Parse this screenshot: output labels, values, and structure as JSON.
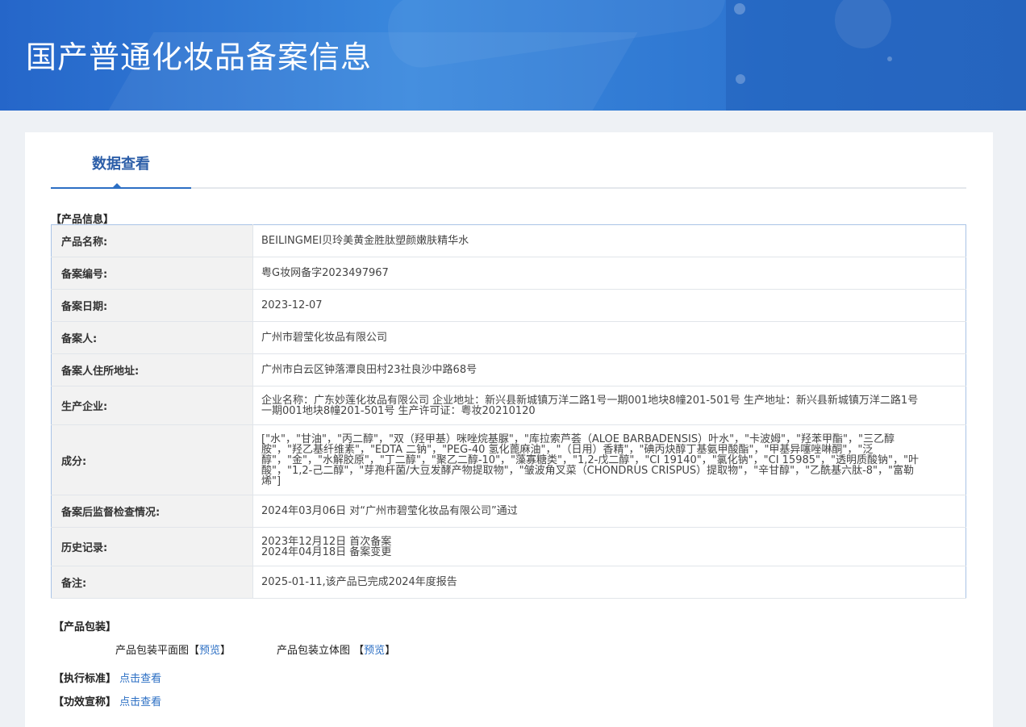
{
  "header": {
    "title": "国产普通化妆品备案信息"
  },
  "tab": {
    "label": "数据查看"
  },
  "product_info": {
    "section_label": "【产品信息】",
    "rows": [
      {
        "key": "产品名称:",
        "value": "BEILINGMEI贝玲美黄金胜肽塑颜嫩肤精华水"
      },
      {
        "key": "备案编号:",
        "value": "粤G妆网备字2023497967"
      },
      {
        "key": "备案日期:",
        "value": "2023-12-07"
      },
      {
        "key": "备案人:",
        "value": "广州市碧莹化妆品有限公司"
      },
      {
        "key": "备案人住所地址:",
        "value": "广州市白云区钟落潭良田村23社良沙中路68号"
      },
      {
        "key": "生产企业:",
        "value": "企业名称：广东妙莲化妆品有限公司 企业地址：新兴县新城镇万洋二路1号一期001地块8幢201-501号 生产地址：新兴县新城镇万洋二路1号一期001地块8幢201-501号 生产许可证：粤妆20210120"
      },
      {
        "key": "成分:",
        "value": "[\"水\"，\"甘油\"，\"丙二醇\"，\"双（羟甲基）咪唑烷基脲\"，\"库拉索芦荟（ALOE BARBADENSIS）叶水\"，\"卡波姆\"，\"羟苯甲酯\"，\"三乙醇胺\"，\"羟乙基纤维素\"，\"EDTA 二钠\"，\"PEG-40 氢化蓖麻油\"，\"（日用）香精\"，\"碘丙炔醇丁基氨甲酸酯\"，\"甲基异噻唑啉酮\"，\"泛醇\"，\"金\"，\"水解胶原\"，\"丁二醇\"，\"聚乙二醇-10\"，\"藻寡糖类\"，\"1,2-戊二醇\"，\"CI 19140\"，\"氯化钠\"，\"CI 15985\"，\"透明质酸钠\"，\"叶酸\"，\"1,2-己二醇\"，\"芽孢杆菌/大豆发酵产物提取物\"，\"皱波角叉菜（CHONDRUS CRISPUS）提取物\"，\"辛甘醇\"，\"乙酰基六肽-8\"，\"富勒烯\"]"
      },
      {
        "key": "备案后监督检查情况:",
        "value": "2024年03月06日 对“广州市碧莹化妆品有限公司”通过"
      },
      {
        "key": "历史记录:",
        "value": "2023年12月12日 首次备案\n2024年04月18日 备案变更"
      },
      {
        "key": "备注:",
        "value": "2025-01-11,该产品已完成2024年度报告"
      }
    ]
  },
  "packaging": {
    "section_label": "【产品包装】",
    "flat_label": "产品包装平面图",
    "flat_bracket_open": "【",
    "flat_link": "预览",
    "flat_bracket_close": "】",
    "stereo_label": "产品包装立体图",
    "stereo_bracket_open": "【",
    "stereo_link": "预览",
    "stereo_bracket_close": "】"
  },
  "standard": {
    "label": "【执行标准】",
    "link": "点击查看"
  },
  "efficacy": {
    "label": "【功效宣称】",
    "link": "点击查看"
  }
}
